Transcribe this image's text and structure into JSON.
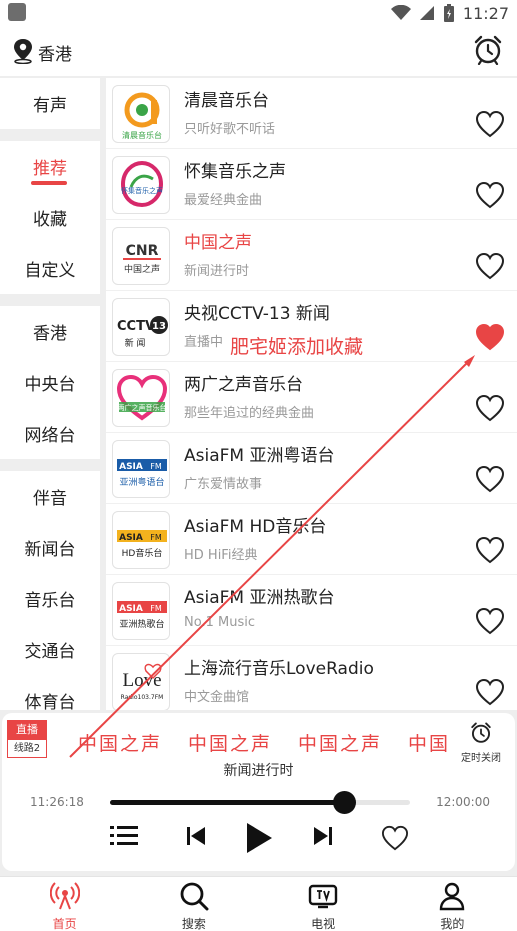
{
  "status_bar": {
    "time": "11:27"
  },
  "header": {
    "location": "香港",
    "alarm_icon": "alarm-clock-icon"
  },
  "sidebar": {
    "groups": [
      [
        "有声"
      ],
      [
        "推荐",
        "收藏",
        "自定义"
      ],
      [
        "香港",
        "中央台",
        "网络台"
      ],
      [
        "伴音",
        "新闻台",
        "音乐台",
        "交通台",
        "体育台"
      ]
    ],
    "active": "推荐"
  },
  "stations": [
    {
      "name": "清晨音乐台",
      "desc": "只听好歌不听话",
      "liked": false
    },
    {
      "name": "怀集音乐之声",
      "desc": "最爱经典金曲",
      "liked": false
    },
    {
      "name": "中国之声",
      "desc": "新闻进行时",
      "liked": false,
      "playing": true
    },
    {
      "name": "央视CCTV-13 新闻",
      "desc": "直播中",
      "liked": true,
      "annotation": "肥宅姬添加收藏"
    },
    {
      "name": "两广之声音乐台",
      "desc": "那些年追过的经典金曲",
      "liked": false
    },
    {
      "name": "AsiaFM 亚洲粤语台",
      "desc": "广东爱情故事",
      "liked": false
    },
    {
      "name": "AsiaFM HD音乐台",
      "desc": "HD HiFi经典",
      "liked": false
    },
    {
      "name": "AsiaFM 亚洲热歌台",
      "desc": "No.1 Music",
      "liked": false
    },
    {
      "name": "上海流行音乐LoveRadio",
      "desc": "中文金曲馆",
      "liked": false
    }
  ],
  "logos": {
    "qingchen": "清晨音乐台",
    "huaiji": "怀集音乐之声",
    "cnr_top": "CNR",
    "cnr_bottom": "中国之声",
    "cctv_top": "CCTV",
    "cctv_num": "13",
    "cctv_bottom": "新 闻",
    "lianguang": "两广之声音乐台",
    "asia_yue_top": "ASIA",
    "asia_yue_bottom": "亚洲粤语台",
    "asia_hd_top": "ASIA",
    "asia_hd_bottom": "HD音乐台",
    "asia_hot_top": "ASIA",
    "asia_hot_bottom": "亚洲热歌台",
    "love_top": "Love",
    "love_bottom": "Radio103.7FM",
    "fm_tag": "FM"
  },
  "player": {
    "live_label": "直播",
    "route_label": "线路2",
    "title": "中国之声",
    "marquee": [
      "中国之声",
      "中国之声",
      "中国之声",
      "中国"
    ],
    "desc": "新闻进行时",
    "timer_label": "定时关闭",
    "time_start": "11:26:18",
    "time_end": "12:00:00",
    "progress": 0.78
  },
  "bottom_nav": [
    {
      "label": "首页",
      "icon": "radio-tower-icon",
      "active": true
    },
    {
      "label": "搜索",
      "icon": "search-icon",
      "active": false
    },
    {
      "label": "电视",
      "icon": "tv-icon",
      "active": false
    },
    {
      "label": "我的",
      "icon": "person-icon",
      "active": false
    }
  ],
  "colors": {
    "accent": "#e84545",
    "logo_orange": "#f39a1e",
    "logo_green": "#3aa447",
    "logo_blue": "#1a5ca8"
  }
}
